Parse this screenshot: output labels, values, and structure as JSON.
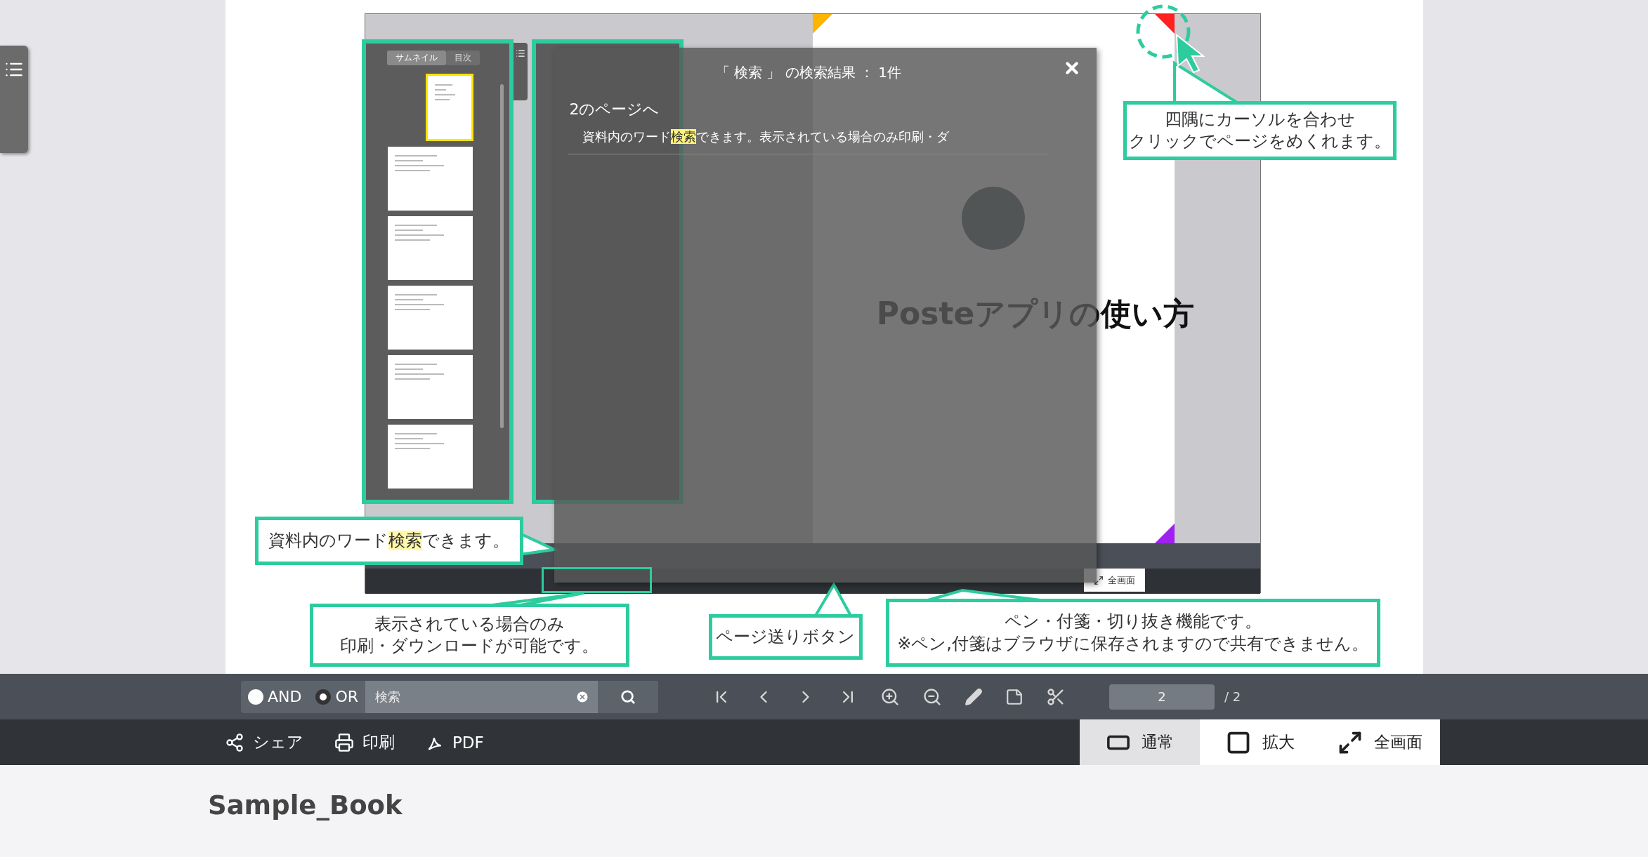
{
  "tutorial_image": {
    "thumbnail_panel": {
      "tabs": [
        {
          "label": "サムネイル",
          "selected": true
        },
        {
          "label": "目次",
          "selected": false
        }
      ],
      "thumbnails": [
        {
          "selected": true
        },
        {
          "selected": false
        },
        {
          "selected": false
        },
        {
          "selected": false
        },
        {
          "selected": false
        },
        {
          "selected": false
        }
      ]
    },
    "page": {
      "title": "Posteアプリの使い方"
    },
    "viewer_toolbar": {
      "fullscreen_label": "全画面"
    },
    "callouts": [
      {
        "lines": [
          "四隅にカーソルを合わせ",
          "クリックでページをめくれます。"
        ]
      },
      {
        "lines": [
          "資料内のワード**検索**できます。"
        ]
      },
      {
        "lines": [
          "表示されている場合のみ",
          "印刷・ダウンロードが可能です。"
        ]
      },
      {
        "lines": [
          "ページ送りボタン"
        ]
      },
      {
        "lines": [
          "ペン・付箋・切り抜き機能です。",
          "※ペン,付箋はブラウザに保存されますので共有できません。"
        ]
      }
    ],
    "search_dialog": {
      "heading": "「 検索 」 の検索結果 ： 1件",
      "result_page": "2のページへ",
      "result_text": "資料内のワード**検索**できます。表示されている場合のみ印刷・ダ"
    }
  },
  "toolbar": {
    "modes": [
      {
        "label": "AND",
        "selected": false
      },
      {
        "label": "OR",
        "selected": true
      }
    ],
    "search_placeholder": "検索",
    "page_value": "2",
    "page_total": "/ 2",
    "actions": [
      {
        "kind": "share",
        "label": "シェア"
      },
      {
        "kind": "print",
        "label": "印刷"
      },
      {
        "kind": "pdf",
        "label": "PDF"
      }
    ],
    "view_modes": [
      {
        "kind": "normal",
        "label": "通常",
        "selected": true
      },
      {
        "kind": "expand",
        "label": "拡大",
        "selected": false
      },
      {
        "kind": "fullscreen",
        "label": "全画面",
        "selected": false
      }
    ]
  },
  "book_title": "Sample_Book"
}
